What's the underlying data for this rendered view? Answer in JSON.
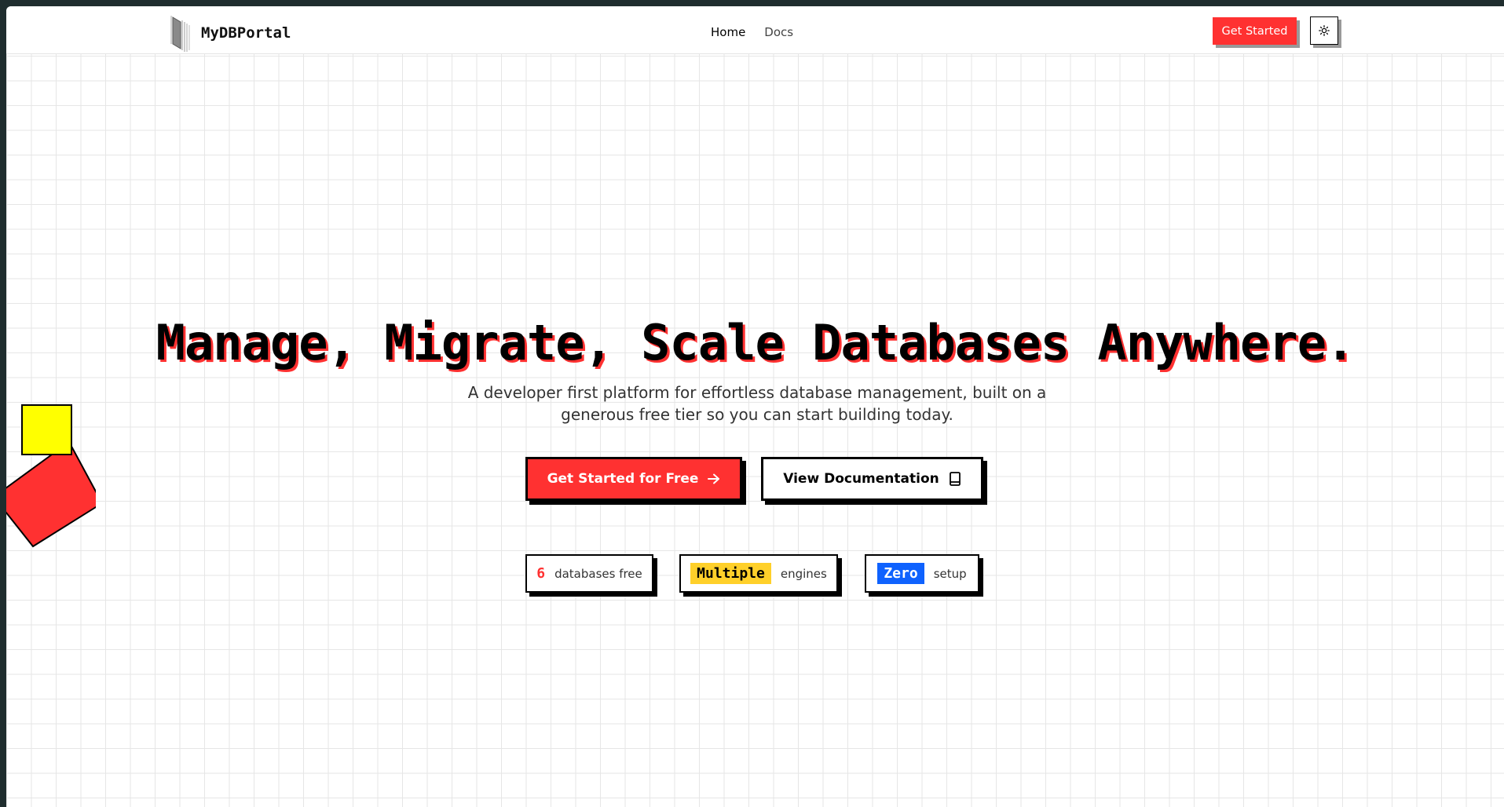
{
  "nav": {
    "brand": "MyDBPortal",
    "links": [
      {
        "label": "Home",
        "active": true
      },
      {
        "label": "Docs",
        "active": false
      }
    ],
    "cta_label": "Get Started",
    "theme_toggle_icon": "sun-icon"
  },
  "hero": {
    "title": "Manage, Migrate, Scale Databases Anywhere.",
    "subtitle": "A developer first platform for effortless database management, built on a generous free tier so you can start building today.",
    "primary_button": {
      "label": "Get Started for Free",
      "icon": "arrow-right-icon"
    },
    "secondary_button": {
      "label": "View Documentation",
      "icon": "book-icon"
    }
  },
  "stats": [
    {
      "value": "6",
      "label": "databases free",
      "accent": "#ff3131"
    },
    {
      "value": "Multiple",
      "label": "engines",
      "accent": "#ffd02a"
    },
    {
      "value": "Zero",
      "label": "setup",
      "accent": "#0f62fe"
    }
  ],
  "colors": {
    "accent_red": "#ff3131",
    "accent_yellow": "#ffd02a",
    "accent_blue": "#0f62fe",
    "decor_yellow": "#ffff00"
  }
}
